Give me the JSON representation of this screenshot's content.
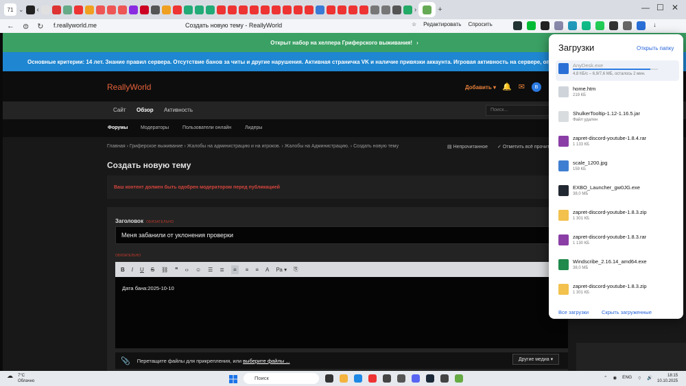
{
  "browser": {
    "tab_count": "71",
    "address": "f.reallyworld.me",
    "page_title": "Создать новую тему - ReallyWorld",
    "actions": {
      "editor": "Редактировать",
      "ask": "Спросить"
    },
    "window_controls": {
      "minimize": "—",
      "maximize": "☐",
      "close": "✕"
    }
  },
  "site": {
    "banner_green": "Открыт набор на хелпера Гриферского выживания!",
    "banner_blue": "Основные критерии: 14 лет. Знание правил сервера. Отсутствие банов за читы и другие нарушения. Активная страничка VK и наличие привязки аккаунта. Игровая активность на сервере, операционной си",
    "logo": "ReallyWorld",
    "add_button": "Добавить",
    "avatar_letter": "В",
    "nav": {
      "home": "Сайт",
      "overview": "Обзор",
      "activity": "Активность"
    },
    "search_placeholder": "Поиск...",
    "subnav": {
      "forums": "Форумы",
      "moderators": "Модераторы",
      "online": "Пользователи онлайн",
      "leaders": "Лидеры"
    },
    "breadcrumb": [
      "Главная",
      "Гриферское выживание",
      "Жалобы на администрацию и на игроков.",
      "Жалобы на Администрацию.",
      "Создать новую тему"
    ],
    "unread": "Непрочитанное",
    "mark_read": "Отметить всё прочитанное",
    "page_heading": "Создать новую тему",
    "notice": "Ваш контент должен быть одобрен модератором перед публикацией",
    "form": {
      "title_label": "Заголовок",
      "required": "ОБЯЗАТЕЛЬНО",
      "title_value": "Меня забанили от уклонения проверки",
      "body_text": "Дата бана:2025-10-10",
      "attach_text": "Перетащите файлы для прикрепления, или",
      "attach_link": "выберите файлы ...",
      "other_media": "Другие медиа"
    }
  },
  "downloads": {
    "title": "Загрузки",
    "open_folder": "Открыть папку",
    "active": {
      "name": "AnyDesk.exe",
      "meta": "4,8 КБ/с – 6,9/7,6 МБ, осталось 2 мин.",
      "progress_pct": 91
    },
    "items": [
      {
        "name": "home.htm",
        "meta": "219 КБ",
        "color": "#cfd4da"
      },
      {
        "name": "ShulkerTooltip-1.12-1.16.5.jar",
        "meta": "Файл удален",
        "color": "#d9dcdf"
      },
      {
        "name": "zapret-discord-youtube-1.8.4.rar",
        "meta": "1 133 КБ",
        "color": "#8b3fa6"
      },
      {
        "name": "scale_1200.jpg",
        "meta": "159 КБ",
        "color": "#3f7fd1"
      },
      {
        "name": "EXBO_Launcher_gw0JG.exe",
        "meta": "38,0 МБ",
        "color": "#222831"
      },
      {
        "name": "zapret-discord-youtube-1.8.3.zip",
        "meta": "1 301 КБ",
        "color": "#f2c14e"
      },
      {
        "name": "zapret-discord-youtube-1.8.3.rar",
        "meta": "1 130 КБ",
        "color": "#8b3fa6"
      },
      {
        "name": "Windscribe_2.16.14_amd64.exe",
        "meta": "38,0 МБ",
        "color": "#1f8a4c"
      },
      {
        "name": "zapret-discord-youtube-1.8.3.zip",
        "meta": "1 301 КБ",
        "color": "#f2c14e"
      }
    ],
    "all": "Все загрузки",
    "hide_done": "Скрыть загруженные"
  },
  "taskbar": {
    "temp": "7°C",
    "weather": "Облачно",
    "search": "Поиск",
    "lang": "ENG",
    "time": "18:15",
    "date": "10.10.2025"
  }
}
